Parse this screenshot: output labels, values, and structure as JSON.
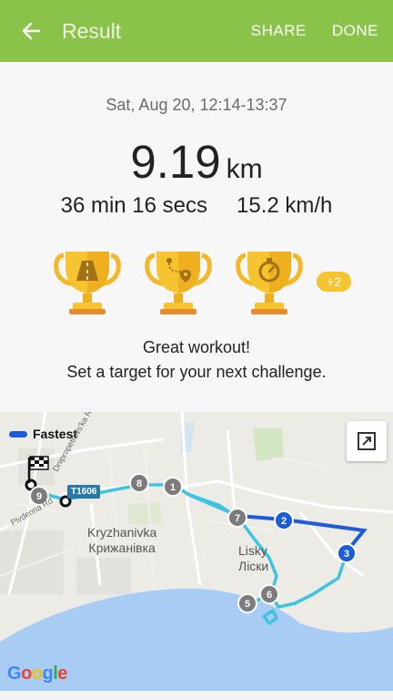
{
  "appbar": {
    "title": "Result",
    "share_label": "SHARE",
    "done_label": "DONE",
    "back_icon": "arrow-left-icon",
    "color": "#8bc34a"
  },
  "workout": {
    "date_range": "Sat, Aug 20, 12:14-13:37",
    "distance_value": "9.19",
    "distance_unit": "km",
    "duration": "36 min 16 secs",
    "speed": "15.2 km/h"
  },
  "achievements": {
    "trophies": [
      {
        "icon": "road-trophy-icon"
      },
      {
        "icon": "route-trophy-icon"
      },
      {
        "icon": "stopwatch-trophy-icon"
      }
    ],
    "more_badge": "+2",
    "badge_color": "#f6c431"
  },
  "message": {
    "line1": "Great workout!",
    "line2": "Set a target for your next challenge."
  },
  "map": {
    "legend_label": "Fastest",
    "legend_color": "#1e5bd9",
    "route_color": "#3ec3e0",
    "road_label": "T1606",
    "place1_en": "Kryzhanivka",
    "place1_uk": "Крижанівка",
    "place2_en": "Lisky",
    "place2_uk": "Ліски",
    "street_a": "Pivdenna Rd",
    "street_b": "Dnipropetrovs'ka Rd",
    "markers": [
      "1",
      "2",
      "3",
      "5",
      "6",
      "7",
      "8",
      "9"
    ],
    "attribution": "Google",
    "expand_icon": "expand-icon",
    "start_icon": "finish-flag-icon"
  }
}
